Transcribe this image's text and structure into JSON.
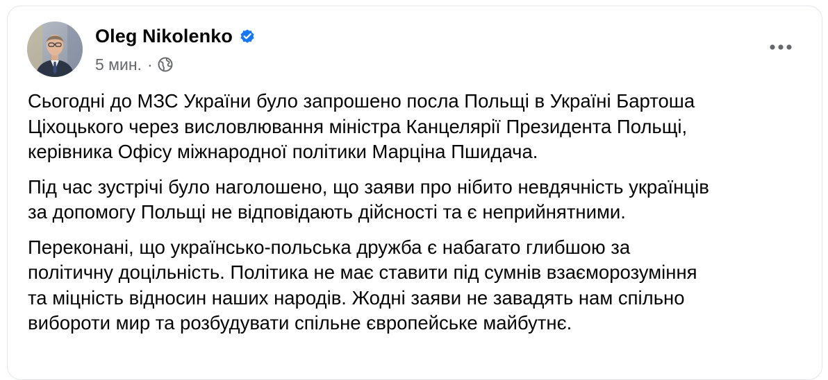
{
  "post": {
    "author": "Oleg Nikolenko",
    "verified": true,
    "timestamp": "5 мин.",
    "meta_separator": "·",
    "privacy_icon": "globe-icon",
    "more_icon": "more-horizontal-icon",
    "paragraphs": [
      {
        "lines": [
          "Сьогодні до МЗС України було запрошено посла Польщі в Україні Бартоша",
          "Ціхоцького через висловлювання міністра Канцелярії Президента Польщі,",
          "керівника Офісу міжнародної політики Марціна Пшидача."
        ]
      },
      {
        "lines": [
          "Під час зустрічі було наголошено, що заяви про нібито невдячність українців",
          "за допомогу Польщі не відповідають дійсності та є неприйнятними."
        ]
      },
      {
        "lines": [
          "Переконані, що українсько-польська дружба є набагато глибшою за",
          "політичну доцільність. Політика не має ставити під сумнів взаєморозуміння",
          "та міцність відносин наших народів. Жодні заяви не завадять нам спільно",
          "вибороти мир та розбудувати спільне європейське майбутнє."
        ]
      }
    ]
  },
  "colors": {
    "text": "#050505",
    "secondary_text": "#65676b",
    "verified_blue": "#1877f2",
    "card_border": "#e4e6eb"
  }
}
